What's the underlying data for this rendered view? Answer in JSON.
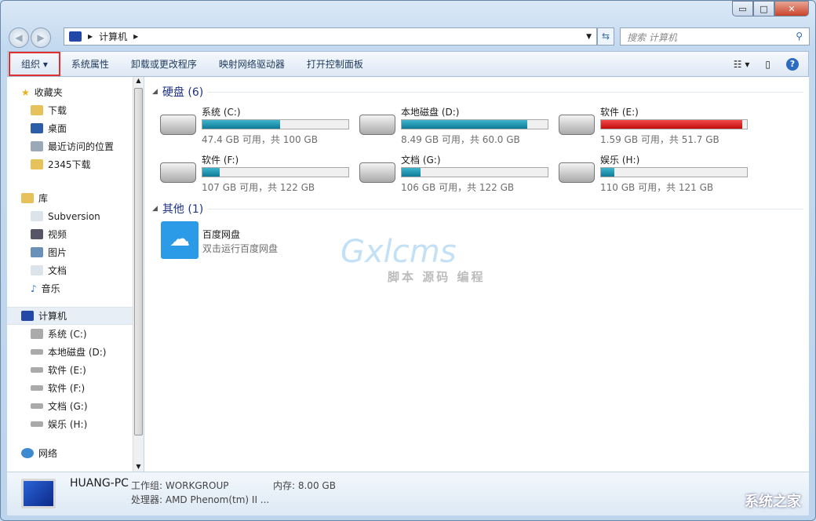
{
  "window": {
    "minimize": "▭",
    "maximize": "□",
    "close": "✕"
  },
  "address": {
    "root_icon": "computer-icon",
    "crumb": "计算机",
    "search_placeholder": "搜索 计算机"
  },
  "toolbar": {
    "organize": "组织 ▾",
    "items": [
      "系统属性",
      "卸载或更改程序",
      "映射网络驱动器",
      "打开控制面板"
    ],
    "help": "?"
  },
  "sidebar": {
    "favorites": {
      "label": "收藏夹",
      "items": [
        "下载",
        "桌面",
        "最近访问的位置",
        "2345下载"
      ]
    },
    "libraries": {
      "label": "库",
      "items": [
        "Subversion",
        "视频",
        "图片",
        "文档",
        "音乐"
      ]
    },
    "computer": {
      "label": "计算机",
      "items": [
        "系统 (C:)",
        "本地磁盘 (D:)",
        "软件 (E:)",
        "软件 (F:)",
        "文档 (G:)",
        "娱乐 (H:)"
      ]
    },
    "network": {
      "label": "网络"
    }
  },
  "main": {
    "hard_disks": {
      "title": "硬盘 (6)",
      "drives": [
        {
          "name": "系统 (C:)",
          "size": "47.4 GB 可用，共 100 GB",
          "used_pct": 53,
          "color": "#1a8fab"
        },
        {
          "name": "本地磁盘 (D:)",
          "size": "8.49 GB 可用，共 60.0 GB",
          "used_pct": 86,
          "color": "#1a8fab"
        },
        {
          "name": "软件 (E:)",
          "size": "1.59 GB 可用，共 51.7 GB",
          "used_pct": 97,
          "color": "#d21a1a"
        },
        {
          "name": "软件 (F:)",
          "size": "107 GB 可用，共 122 GB",
          "used_pct": 12,
          "color": "#1a8fab"
        },
        {
          "name": "文档 (G:)",
          "size": "106 GB 可用，共 122 GB",
          "used_pct": 13,
          "color": "#1a8fab"
        },
        {
          "name": "娱乐 (H:)",
          "size": "110 GB 可用，共 121 GB",
          "used_pct": 9,
          "color": "#1a8fab"
        }
      ]
    },
    "other": {
      "title": "其他 (1)",
      "items": [
        {
          "name": "百度网盘",
          "desc": "双击运行百度网盘"
        }
      ]
    },
    "watermark": {
      "brand": "Gxlcms",
      "sub": "脚本 源码 编程"
    }
  },
  "status": {
    "pc_name": "HUANG-PC",
    "workgroup": "工作组: WORKGROUP",
    "memory": "内存: 8.00 GB",
    "cpu": "处理器: AMD Phenom(tm) II ...",
    "site_logo": "系统之家"
  }
}
